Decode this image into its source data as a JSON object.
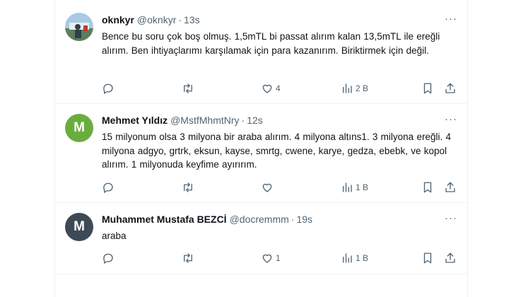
{
  "tweets": [
    {
      "name": "oknkyr",
      "handle": "@oknkyr",
      "time": "13s",
      "text": "Bence bu soru çok boş olmuş. 1,5mTL bi passat alırım kalan 13,5mTL ile ereğli alırım. Ben ihtiyaçlarımı karşılamak için para kazanırım. Biriktirmek için değil.",
      "avatar": {
        "type": "photo",
        "color": "#8ab4d8"
      },
      "replies": "",
      "retweets": "",
      "likes": "4",
      "views": "2 B"
    },
    {
      "name": "Mehmet Yıldız",
      "handle": "@MstfMhmtNry",
      "time": "12s",
      "text": "15 milyonum olsa 3 milyona bir araba alırım. 4 milyona altıns1. 3 milyona ereğli. 4 milyona  adgyo, grtrk, eksun, kayse, smrtg, cwene, karye, gedza, ebebk, ve kopol alırım. 1 milyonuda keyfime ayırırım.",
      "avatar": {
        "type": "letter",
        "letter": "M",
        "color": "#6bad3d"
      },
      "replies": "",
      "retweets": "",
      "likes": "",
      "views": "1 B"
    },
    {
      "name": "Muhammet Mustafa BEZCİ",
      "handle": "@docremmm",
      "time": "19s",
      "text": "araba",
      "avatar": {
        "type": "letter",
        "letter": "M",
        "color": "#3d4a55"
      },
      "replies": "",
      "retweets": "",
      "likes": "1",
      "views": "1 B"
    }
  ],
  "more_glyph": "···"
}
